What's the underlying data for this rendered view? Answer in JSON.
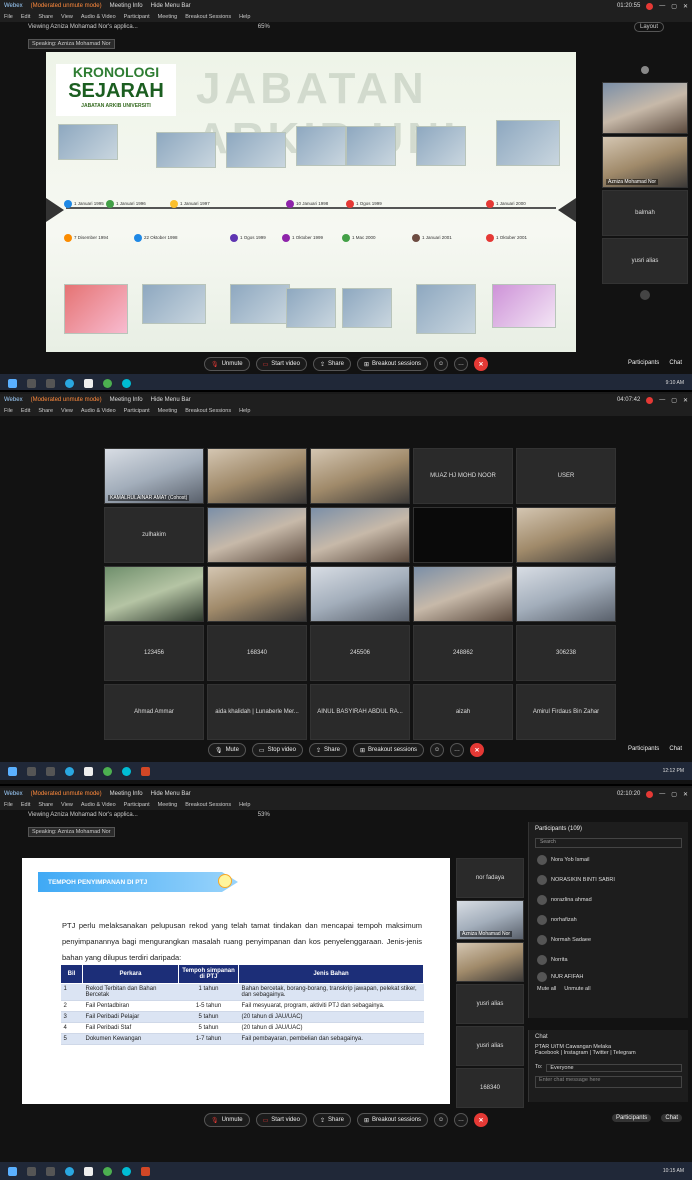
{
  "shot1": {
    "window_title": "Webex",
    "recording_text": "(Moderated unmute mode)",
    "meeting_info": "Meeting Info",
    "hide_menu": "Hide Menu Bar",
    "time": "01:20:55",
    "menu": [
      "File",
      "Edit",
      "Share",
      "View",
      "Audio & Video",
      "Participant",
      "Meeting",
      "Breakout Sessions",
      "Help"
    ],
    "viewing": "Viewing Azniza Mohamad Nor's applica...",
    "zoom": "65%",
    "speaking": "Speaking: Azniza Mohamad Nor",
    "layout": "Layout",
    "slide_title1": "KRONOLOGI",
    "slide_title2": "SEJARAH",
    "slide_title3": "JABATAN ARKIB UNIVERSITI",
    "bg_text": "JABATAN ARKIB UNI",
    "dates_top": [
      "1 Januari 1995",
      "1 Januari 1996",
      "1 Januari 1997",
      "10 Januari 1998",
      "1 Ogos 1999",
      "1 Januari 2000"
    ],
    "dates_bottom": [
      "7 Disember 1994",
      "22 Oktober 1998",
      "1 Ogos 1999",
      "1 Oktober 1999",
      "1 Mac 2000",
      "1 Januari 2001",
      "1 Oktober 2001",
      "1 Julai 2001"
    ],
    "panel_names": [
      "Azniza Mohamad Nor",
      "balmah",
      "yusri alias"
    ],
    "controls": {
      "unmute": "Unmute",
      "start_video": "Start video",
      "share": "Share",
      "breakout": "Breakout sessions",
      "participants": "Participants",
      "chat": "Chat"
    },
    "clock": "9:10 AM"
  },
  "shot2": {
    "window_title": "Webex",
    "recording_text": "(Moderated unmute mode)",
    "meeting_info": "Meeting Info",
    "hide_menu": "Hide Menu Bar",
    "time": "04:07:42",
    "menu": [
      "File",
      "Edit",
      "Share",
      "View",
      "Audio & Video",
      "Participant",
      "Meeting",
      "Breakout Sessions",
      "Help"
    ],
    "grid": [
      [
        "KAMALRULAINAR AMAT (Cohost)",
        "",
        "",
        "MUAZ HJ MOHD NOOR",
        "USER"
      ],
      [
        "zulhakim",
        "",
        "",
        "",
        ""
      ],
      [
        "",
        "",
        "",
        "",
        ""
      ],
      [
        "123456",
        "168340",
        "245506",
        "248862",
        "306238"
      ],
      [
        "Ahmad Ammar",
        "aida khalidah | Lunaberle Mer...",
        "AINUL BASYIRAH ABDUL RA...",
        "aizah",
        "Amirul Firdaus Bin Zahar"
      ]
    ],
    "controls": {
      "mute": "Mute",
      "stop_video": "Stop video",
      "share": "Share",
      "breakout": "Breakout sessions",
      "participants": "Participants",
      "chat": "Chat"
    },
    "clock": "12:12 PM"
  },
  "shot3": {
    "window_title": "Webex",
    "recording_text": "(Moderated unmute mode)",
    "meeting_info": "Meeting Info",
    "hide_menu": "Hide Menu Bar",
    "time": "02:10:20",
    "menu": [
      "File",
      "Edit",
      "Share",
      "View",
      "Audio & Video",
      "Participant",
      "Meeting",
      "Breakout Sessions",
      "Help"
    ],
    "viewing": "Viewing Azniza Mohamad Nor's applica...",
    "zoom": "53%",
    "speaking": "Speaking: Azniza Mohamad Nor",
    "banner": "TEMPOH PENYIMPANAN DI PTJ",
    "paragraph": "PTJ perlu melaksanakan pelupusan rekod yang telah tamat tindakan dan mencapai tempoh maksimum penyimpanannya bagi mengurangkan masalah ruang penyimpanan dan kos penyelenggaraan. Jenis-jenis bahan yang dilupus terdiri daripada:",
    "table_headers": [
      "Bil",
      "Perkara",
      "Tempoh simpanan di PTJ",
      "Jenis Bahan"
    ],
    "table_rows": [
      [
        "1",
        "Rekod Terbitan dan Bahan Bercetak",
        "1 tahun",
        "Bahan bercetak, borang-borang, transkrip jawapan, pelekat stiker, dan sebagainya."
      ],
      [
        "2",
        "Fail Pentadbiran",
        "1-5 tahun",
        "Fail mesyuarat, program, aktiviti PTJ dan sebagainya."
      ],
      [
        "3",
        "Fail Peribadi Pelajar",
        "5 tahun",
        "(20 tahun di JAU/UAC)"
      ],
      [
        "4",
        "Fail Peribadi Staf",
        "5 tahun",
        "(20 tahun di JAU/UAC)"
      ],
      [
        "5",
        "Dokumen Kewangan",
        "1-7 tahun",
        "Fail pembayaran, pembelian dan sebagainya."
      ]
    ],
    "side_tiles": [
      "nor fadaya",
      "Azniza Mohamad Nor",
      "",
      "yusri alias",
      "yusri alias",
      "168340"
    ],
    "participants_header": "Participants (109)",
    "search_placeholder": "Search",
    "participants": [
      "Nora Yob Ismail",
      "NORASIKIN BINTI SABRI",
      "norazlina ahmad",
      "norhafizah",
      "Normah Sadaee",
      "Norrita",
      "NUR AFIFAH"
    ],
    "mute_all": "Mute all",
    "unmute_all": "Unmute all",
    "chat_header": "Chat",
    "chat_msg1": "PTAR UiTM Cawangan Melaka",
    "chat_msg2": "Facebook | Instagram | Twitter | Telegram",
    "to_label": "To:",
    "to_value": "Everyone",
    "chat_placeholder": "Enter chat message here",
    "controls": {
      "unmute": "Unmute",
      "start_video": "Start video",
      "share": "Share",
      "breakout": "Breakout sessions",
      "participants": "Participants",
      "chat": "Chat"
    },
    "clock": "10:15 AM"
  }
}
